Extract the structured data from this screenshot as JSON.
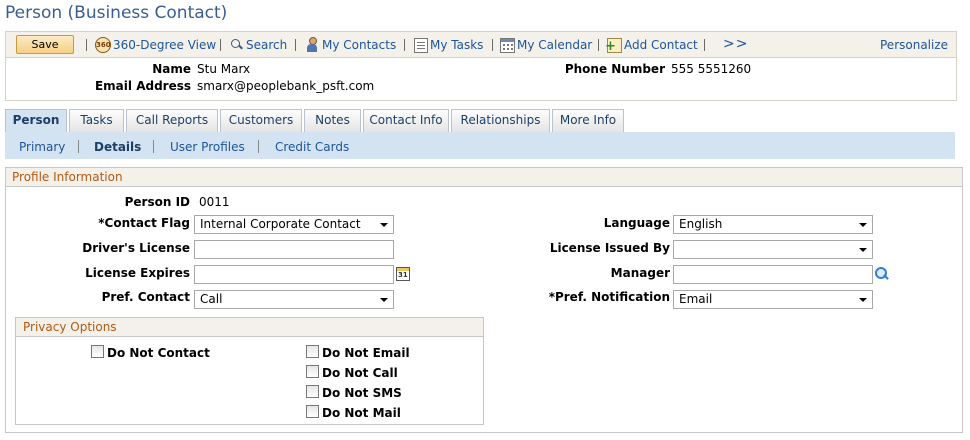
{
  "page": {
    "title": "Person (Business Contact)"
  },
  "toolbar": {
    "save_label": "Save",
    "links": {
      "view360": "360-Degree View",
      "search": "Search",
      "my_contacts": "My Contacts",
      "my_tasks": "My Tasks",
      "my_calendar": "My Calendar",
      "add_contact": "Add Contact"
    },
    "more_label": ">>",
    "personalize_label": "Personalize",
    "icons": [
      "360-icon",
      "search-icon",
      "contacts-icon",
      "tasks-icon",
      "calendar-icon",
      "add-contact-icon"
    ]
  },
  "header": {
    "name_label": "Name",
    "name_value": "Stu Marx",
    "email_label": "Email Address",
    "email_value": "smarx@peoplebank_psft.com",
    "phone_label": "Phone Number",
    "phone_value": "555 5551260"
  },
  "tabs": [
    "Person",
    "Tasks",
    "Call Reports",
    "Customers",
    "Notes",
    "Contact Info",
    "Relationships",
    "More Info"
  ],
  "active_tab": "Person",
  "subtabs": [
    "Primary",
    "Details",
    "User Profiles",
    "Credit Cards"
  ],
  "active_subtab": "Details",
  "profile": {
    "section_title": "Profile Information",
    "person_id_label": "Person ID",
    "person_id_value": "0011",
    "contact_flag_label": "*Contact Flag",
    "contact_flag_value": "Internal Corporate Contact",
    "drivers_license_label": "Driver's License",
    "drivers_license_value": "",
    "license_expires_label": "License Expires",
    "license_expires_value": "",
    "pref_contact_label": "Pref. Contact",
    "pref_contact_value": "Call",
    "language_label": "Language",
    "language_value": "English",
    "license_issued_by_label": "License Issued By",
    "license_issued_by_value": "",
    "manager_label": "Manager",
    "manager_value": "",
    "pref_notification_label": "*Pref. Notification",
    "pref_notification_value": "Email"
  },
  "privacy": {
    "section_title": "Privacy Options",
    "do_not_contact": "Do Not Contact",
    "do_not_email": "Do Not Email",
    "do_not_call": "Do Not Call",
    "do_not_sms": "Do Not SMS",
    "do_not_mail": "Do Not Mail"
  },
  "colors": {
    "link": "#1d5599",
    "title": "#3a5d8f",
    "section_heading": "#b15a12",
    "tab_bar": "#d3e3f2",
    "save_button": "#f6cf85"
  }
}
